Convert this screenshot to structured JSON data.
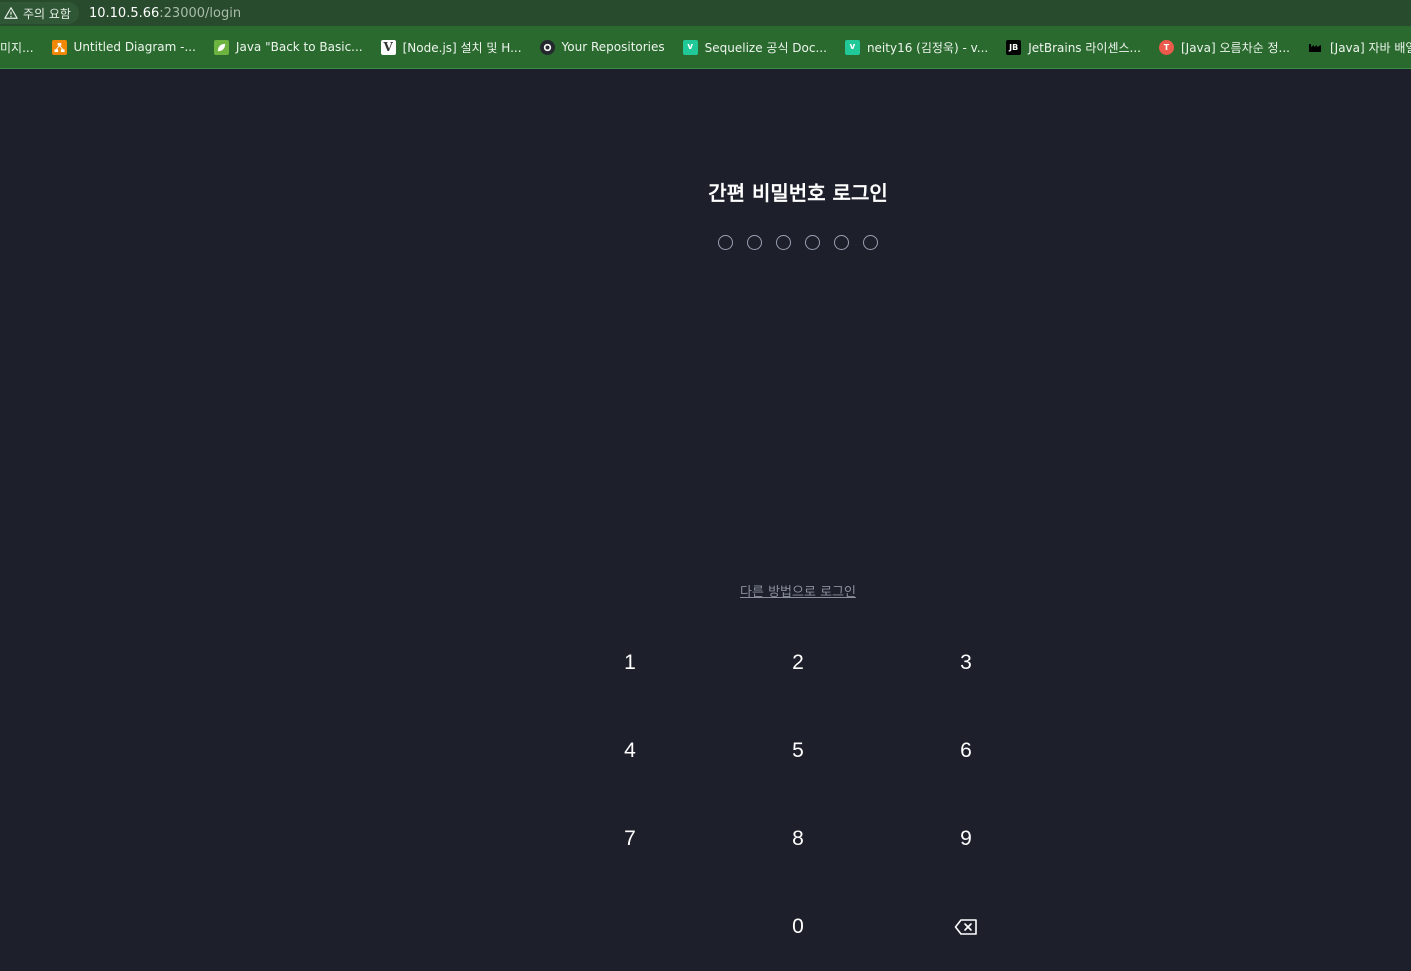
{
  "browser": {
    "security_label": "주의 요함",
    "url_host": "10.10.5.66",
    "url_path": ":23000/login",
    "bookmarks": [
      {
        "label": "미지...",
        "icon": "none",
        "color": ""
      },
      {
        "label": "Untitled Diagram -...",
        "icon": "drawio-icon",
        "color": "#f08705"
      },
      {
        "label": "Java \"Back to Basic...",
        "icon": "leaf-icon",
        "color": "#6db33f"
      },
      {
        "label": "[Node.js] 설치 및 H...",
        "icon": "velog-v-icon",
        "color": "#ffffff"
      },
      {
        "label": "Your Repositories",
        "icon": "github-icon",
        "color": "#24292e"
      },
      {
        "label": "Sequelize 공식 Doc...",
        "icon": "velog-icon",
        "color": "#20c997"
      },
      {
        "label": "neity16 (김정욱) - v...",
        "icon": "velog-icon",
        "color": "#20c997"
      },
      {
        "label": "JetBrains 라이센스...",
        "icon": "jetbrains-icon",
        "color": "#000000"
      },
      {
        "label": "[Java] 오름차순 정...",
        "icon": "tistory-icon",
        "color": "#eb5a4b"
      },
      {
        "label": "[Java] 자바 배열 정...",
        "icon": "factory-icon",
        "color": "#000000"
      }
    ]
  },
  "login": {
    "title": "간편 비밀번호 로그인",
    "pin_length": 6,
    "alt_login_label": "다른 방법으로 로그인",
    "keys": [
      "1",
      "2",
      "3",
      "4",
      "5",
      "6",
      "7",
      "8",
      "9",
      "",
      "0",
      "backspace"
    ]
  },
  "colors": {
    "background": "#1d1f2b",
    "addressbar": "#284a2d",
    "bookmarks_bar": "#2a6a2f"
  }
}
